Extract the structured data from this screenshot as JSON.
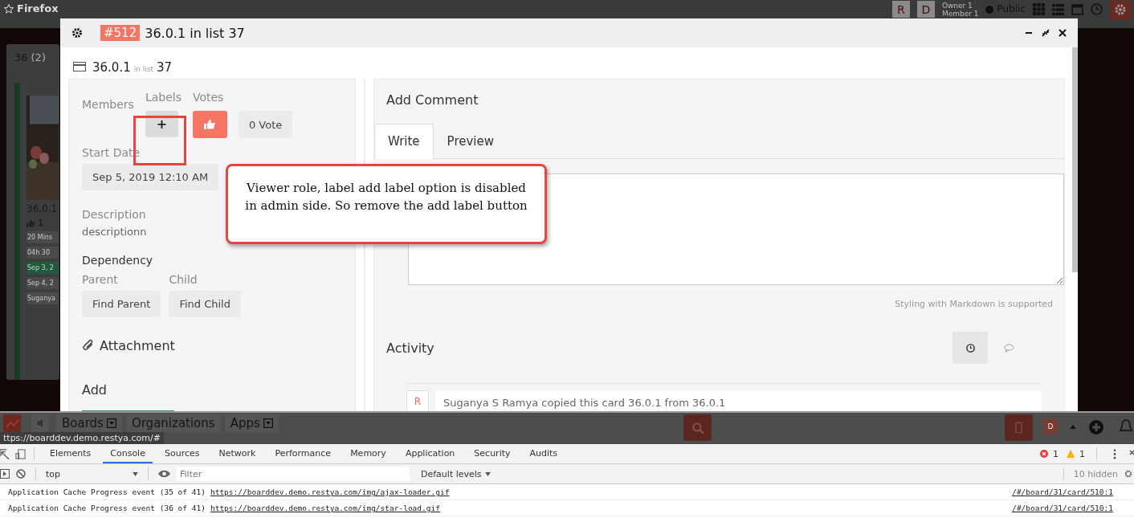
{
  "topbar": {
    "title": "Firefox",
    "avatars": [
      "R",
      "D"
    ],
    "roles": [
      "Owner 1",
      "Member 1"
    ],
    "visibility": "Public"
  },
  "list": {
    "title": "36",
    "count": "(2)",
    "card_title": "36.0.1",
    "votes": "1",
    "badges": [
      {
        "text": "20 Mins",
        "color": "#4a4a4a"
      },
      {
        "text": "04h 30",
        "color": "#4a4a4a"
      },
      {
        "text": "Sep 3, 2",
        "color": "#1f5a3c"
      },
      {
        "text": "Sep 4, 2",
        "color": "#4a4a4a"
      },
      {
        "text": "Suganya",
        "color": "#4a4a4a"
      }
    ]
  },
  "modal": {
    "card_number": "#512",
    "title": "36.0.1 in list 37",
    "card_name": "36.0.1",
    "list_prefix": "in list",
    "list_name": "37",
    "members_label": "Members",
    "labels_label": "Labels",
    "add_label_button": "+",
    "votes_label": "Votes",
    "vote_count": "0 Vote",
    "start_date_label": "Start Date",
    "start_date": "Sep 5, 2019 12:10 AM",
    "description_label": "Description",
    "description": "descriptionn",
    "dependency_label": "Dependency",
    "parent_label": "Parent",
    "child_label": "Child",
    "find_parent": "Find Parent",
    "find_child": "Find Child",
    "attachment_label": "Attachment",
    "add_label": "Add",
    "comment": {
      "title": "Add Comment",
      "tabs": [
        {
          "label": "Write",
          "selected": true
        },
        {
          "label": "Preview",
          "selected": false
        }
      ],
      "hint": "Styling with Markdown is supported"
    },
    "activity": {
      "title": "Activity",
      "filters": [
        {
          "kind": "clock",
          "selected": true
        },
        {
          "kind": "comment",
          "selected": false
        }
      ],
      "avatar": "R",
      "entry": "Suganya S Ramya copied this card 36.0.1 from 36.0.1"
    }
  },
  "callout": "Viewer role, label add label option is disabled in admin side. So remove the add label button",
  "appbar": {
    "menus": [
      {
        "label": "Boards",
        "dropdown": true
      },
      {
        "label": "Organizations",
        "dropdown": false
      },
      {
        "label": "Apps",
        "dropdown": true
      }
    ],
    "avatar": "D",
    "status_url": "ttps://boarddev.demo.restya.com/#"
  },
  "devtools": {
    "tabs": [
      {
        "label": "Elements",
        "selected": false
      },
      {
        "label": "Console",
        "selected": true
      },
      {
        "label": "Sources",
        "selected": false
      },
      {
        "label": "Network",
        "selected": false
      },
      {
        "label": "Performance",
        "selected": false
      },
      {
        "label": "Memory",
        "selected": false
      },
      {
        "label": "Application",
        "selected": false
      },
      {
        "label": "Security",
        "selected": false
      },
      {
        "label": "Audits",
        "selected": false
      }
    ],
    "errors": "1",
    "warnings": "1",
    "context": "top",
    "filter_placeholder": "Filter",
    "levels": "Default levels",
    "hidden": "10 hidden",
    "logs": [
      {
        "message": "Application Cache Progress event (35 of 41)",
        "link": "https://boarddev.demo.restya.com/img/ajax-loader.gif",
        "source": "/#/board/31/card/510:1"
      },
      {
        "message": "Application Cache Progress event (36 of 41)",
        "link": "https://boarddev.demo.restya.com/img/star-load.gif",
        "source": "/#/board/31/card/510:1"
      }
    ]
  }
}
